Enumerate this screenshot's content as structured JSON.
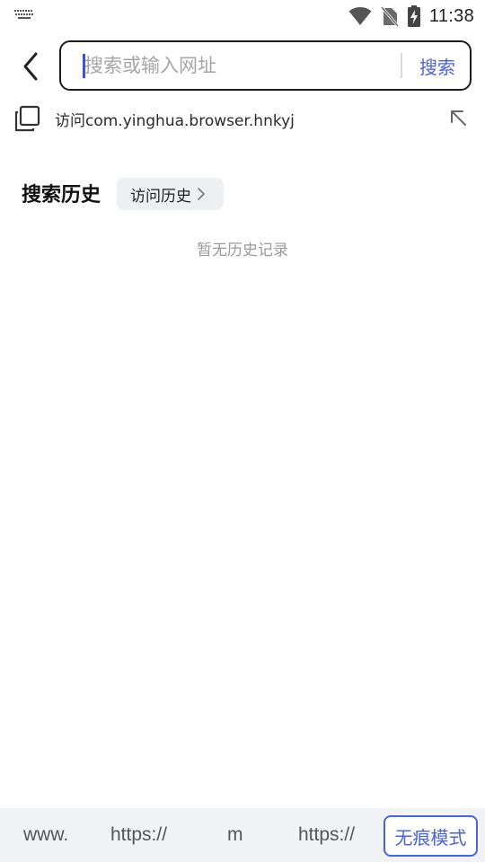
{
  "status_bar": {
    "time": "11:38",
    "icons": [
      "keyboard-icon",
      "wifi-icon",
      "no-sim-icon",
      "battery-charging-icon"
    ]
  },
  "header": {
    "back_icon": "chevron-left-icon",
    "search_placeholder": "搜索或输入网址",
    "search_value": "",
    "search_button_label": "搜索",
    "accent_color": "#4a63d8"
  },
  "suggestion": {
    "icon": "copy-icon",
    "text": "访问com.yinghua.browser.hnkyj",
    "action_icon": "arrow-up-left-icon"
  },
  "history": {
    "title": "搜索历史",
    "visit_history_label": "访问历史",
    "empty_text": "暂无历史记录"
  },
  "quick_bar": {
    "items": [
      "www.",
      "https://",
      "m",
      "https://"
    ],
    "incognito_label": "无痕模式"
  }
}
